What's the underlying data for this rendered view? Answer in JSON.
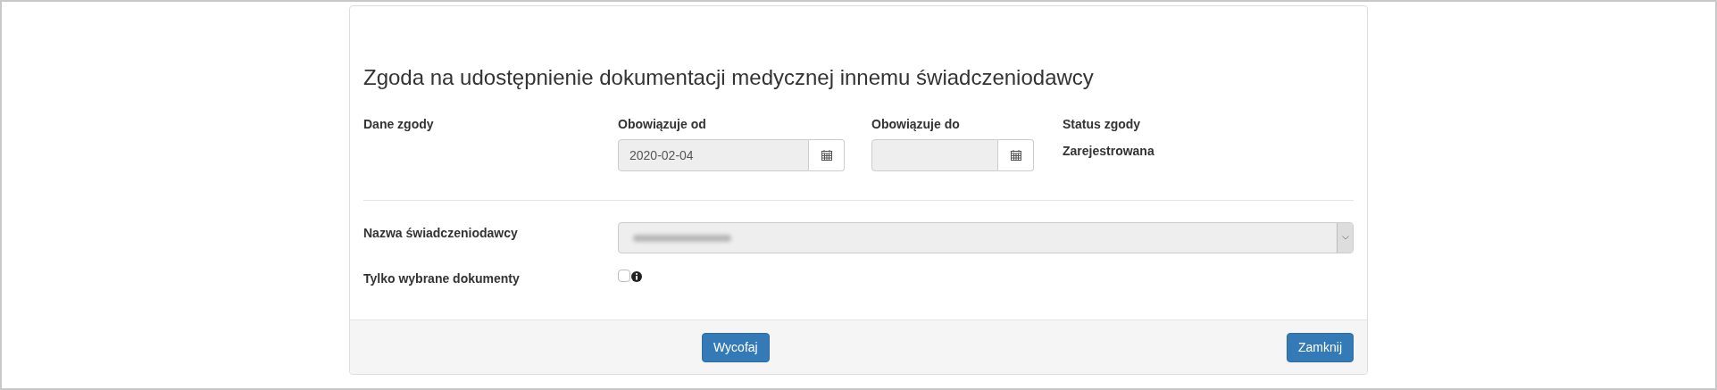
{
  "dialog": {
    "title": "Zgoda na udostępnienie dokumentacji medycznej innemu świadczeniodawcy"
  },
  "consent": {
    "label": "Dane zgody",
    "valid_from": {
      "label": "Obowiązuje od",
      "value": "2020-02-04",
      "disabled": true
    },
    "valid_to": {
      "label": "Obowiązuje do",
      "disabled": true
    },
    "status": {
      "label": "Status zgody",
      "value": "Zarejestrowana"
    }
  },
  "provider": {
    "label": "Nazwa świadczeniodawcy",
    "disabled": true
  },
  "only_selected": {
    "label": "Tylko wybrane dokumenty",
    "checked": false
  },
  "footer": {
    "buttons": [
      {
        "label": "Wycofaj",
        "kind": "center"
      },
      {
        "label": "Zamknij",
        "kind": "right"
      }
    ]
  }
}
